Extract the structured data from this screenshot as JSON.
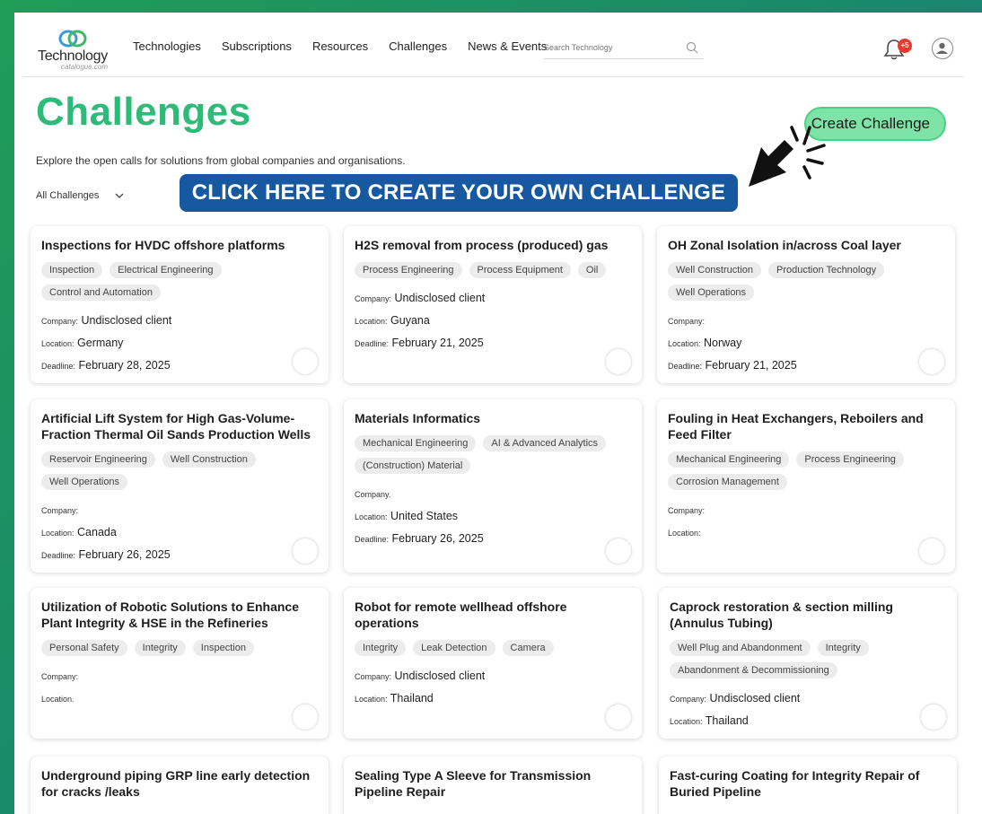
{
  "header": {
    "logo_title": "Technology",
    "logo_sub": "catalogue.com",
    "nav": [
      "Technologies",
      "Subscriptions",
      "Resources",
      "Challenges",
      "News & Events"
    ],
    "search_placeholder": "Search Technology",
    "notification_badge": "+5"
  },
  "page": {
    "title": "Challenges",
    "create_button": "Create Challenge",
    "intro": "Explore the open calls for solutions from global companies and organisations.",
    "filter_label": "All Challenges",
    "banner": "CLICK HERE TO CREATE YOUR OWN CHALLENGE"
  },
  "cards": [
    {
      "title": "Inspections for HVDC offshore platforms",
      "tags": [
        "Inspection",
        "Electrical Engineering",
        "Control and Automation"
      ],
      "company_label": "Company:",
      "company": "Undisclosed client",
      "location_label": "Location:",
      "location": "Germany",
      "deadline_label": "Deadline:",
      "deadline": "February 28, 2025"
    },
    {
      "title": "H2S removal from process (produced) gas",
      "tags": [
        "Process Engineering",
        "Process Equipment",
        "Oil"
      ],
      "company_label": "Company:",
      "company": "Undisclosed client",
      "location_label": "Location:",
      "location": "Guyana",
      "deadline_label": "Deadline:",
      "deadline": "February 21, 2025"
    },
    {
      "title": "OH Zonal Isolation in/across Coal layer",
      "tags": [
        "Well Construction",
        "Production Technology",
        "Well Operations"
      ],
      "company_label": "Company:",
      "company": "",
      "location_label": "Location:",
      "location": "Norway",
      "deadline_label": "Deadline:",
      "deadline": "February 21, 2025"
    },
    {
      "title": "Artificial Lift System for High Gas-Volume-Fraction Thermal Oil Sands Production Wells",
      "tags": [
        "Reservoir Engineering",
        "Well Construction",
        "Well Operations"
      ],
      "company_label": "Company:",
      "company": "",
      "location_label": "Location:",
      "location": "Canada",
      "deadline_label": "Deadline:",
      "deadline": "February 26, 2025"
    },
    {
      "title": "Materials Informatics",
      "tags": [
        "Mechanical Engineering",
        "AI & Advanced Analytics",
        "(Construction) Material"
      ],
      "company_label": "Company.",
      "company": "",
      "location_label": "Location:",
      "location": "United States",
      "deadline_label": "Deadline:",
      "deadline": "February 26, 2025"
    },
    {
      "title": "Fouling in Heat Exchangers, Reboilers and Feed Filter",
      "tags": [
        "Mechanical Engineering",
        "Process Engineering",
        "Corrosion Management"
      ],
      "company_label": "Company:",
      "company": "",
      "location_label": "Location:",
      "location": "",
      "deadline_label": "",
      "deadline": ""
    },
    {
      "title": "Utilization of Robotic Solutions to Enhance Plant Integrity & HSE in the Refineries",
      "tags": [
        "Personal Safety",
        "Integrity",
        "Inspection"
      ],
      "company_label": "Company:",
      "company": "",
      "location_label": "Location.",
      "location": "",
      "deadline_label": "",
      "deadline": ""
    },
    {
      "title": "Robot for remote wellhead offshore operations",
      "tags": [
        "Integrity",
        "Leak Detection",
        "Camera"
      ],
      "company_label": "Company:",
      "company": "Undisclosed client",
      "location_label": "Location:",
      "location": "Thailand",
      "deadline_label": "",
      "deadline": ""
    },
    {
      "title": "Caprock restoration & section milling (Annulus Tubing)",
      "tags": [
        "Well Plug and Abandonment",
        "Integrity",
        "Abandonment & Decommissioning"
      ],
      "company_label": "Company:",
      "company": "Undisclosed client",
      "location_label": "Location:",
      "location": "Thailand",
      "deadline_label": "",
      "deadline": ""
    },
    {
      "title": "Underground piping GRP line early detection for cracks /leaks",
      "tags": [],
      "company_label": "",
      "company": "",
      "location_label": "",
      "location": "",
      "deadline_label": "",
      "deadline": ""
    },
    {
      "title": "Sealing Type A Sleeve for Transmission Pipeline Repair",
      "tags": [],
      "company_label": "",
      "company": "",
      "location_label": "",
      "location": "",
      "deadline_label": "",
      "deadline": ""
    },
    {
      "title": "Fast-curing Coating for Integrity Repair of Buried Pipeline",
      "tags": [],
      "company_label": "",
      "company": "",
      "location_label": "",
      "location": "",
      "deadline_label": "",
      "deadline": ""
    }
  ]
}
